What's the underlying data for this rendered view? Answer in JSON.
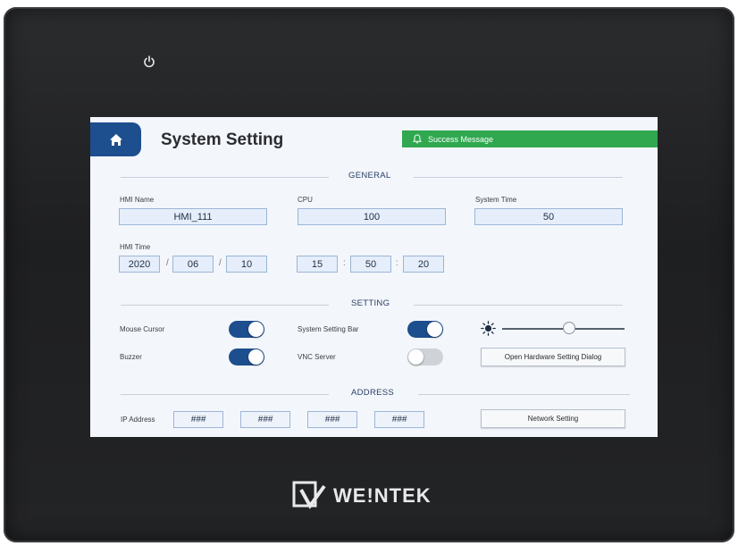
{
  "device": {
    "brand_name": "WE!NTEK",
    "power_icon": "power-icon"
  },
  "header": {
    "title": "System Setting",
    "home_icon": "home-icon",
    "notification": "Success Message",
    "notification_icon": "bell-icon"
  },
  "general": {
    "section_title": "GENERAL",
    "hmi_name_label": "HMI Name",
    "hmi_name_value": "HMI_111",
    "cpu_label": "CPU",
    "cpu_value": "100",
    "system_time_label": "System Time",
    "system_time_value": "50",
    "hmi_time_label": "HMI Time",
    "date": {
      "year": "2020",
      "month": "06",
      "day": "10",
      "separator": "/"
    },
    "time": {
      "hour": "15",
      "minute": "50",
      "second": "20",
      "separator": ":"
    }
  },
  "setting": {
    "section_title": "SETTING",
    "mouse_cursor_label": "Mouse Cursor",
    "mouse_cursor_on": true,
    "buzzer_label": "Buzzer",
    "buzzer_on": true,
    "system_setting_bar_label": "System Setting Bar",
    "system_setting_bar_on": true,
    "vnc_server_label": "VNC Server",
    "vnc_server_on": false,
    "brightness_icon": "sun-icon",
    "brightness_level": 0.55,
    "hardware_dialog_button": "Open Hardware Setting Dialog"
  },
  "address": {
    "section_title": "ADDRESS",
    "ip_label": "IP Address",
    "ip_parts": [
      "###",
      "###",
      "###",
      "###"
    ],
    "network_button": "Network Setting"
  },
  "colors": {
    "primary": "#1d4e8e",
    "success": "#2fa84f",
    "field_bg": "#e5eefa",
    "bezel": "#232426"
  }
}
